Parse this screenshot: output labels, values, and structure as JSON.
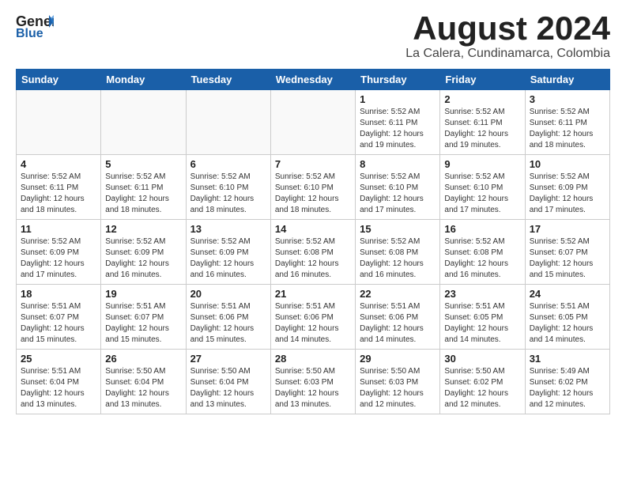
{
  "header": {
    "logo_general": "General",
    "logo_blue": "Blue",
    "month_title": "August 2024",
    "location": "La Calera, Cundinamarca, Colombia"
  },
  "weekdays": [
    "Sunday",
    "Monday",
    "Tuesday",
    "Wednesday",
    "Thursday",
    "Friday",
    "Saturday"
  ],
  "weeks": [
    [
      {
        "day": "",
        "info": ""
      },
      {
        "day": "",
        "info": ""
      },
      {
        "day": "",
        "info": ""
      },
      {
        "day": "",
        "info": ""
      },
      {
        "day": "1",
        "info": "Sunrise: 5:52 AM\nSunset: 6:11 PM\nDaylight: 12 hours\nand 19 minutes."
      },
      {
        "day": "2",
        "info": "Sunrise: 5:52 AM\nSunset: 6:11 PM\nDaylight: 12 hours\nand 19 minutes."
      },
      {
        "day": "3",
        "info": "Sunrise: 5:52 AM\nSunset: 6:11 PM\nDaylight: 12 hours\nand 18 minutes."
      }
    ],
    [
      {
        "day": "4",
        "info": "Sunrise: 5:52 AM\nSunset: 6:11 PM\nDaylight: 12 hours\nand 18 minutes."
      },
      {
        "day": "5",
        "info": "Sunrise: 5:52 AM\nSunset: 6:11 PM\nDaylight: 12 hours\nand 18 minutes."
      },
      {
        "day": "6",
        "info": "Sunrise: 5:52 AM\nSunset: 6:10 PM\nDaylight: 12 hours\nand 18 minutes."
      },
      {
        "day": "7",
        "info": "Sunrise: 5:52 AM\nSunset: 6:10 PM\nDaylight: 12 hours\nand 18 minutes."
      },
      {
        "day": "8",
        "info": "Sunrise: 5:52 AM\nSunset: 6:10 PM\nDaylight: 12 hours\nand 17 minutes."
      },
      {
        "day": "9",
        "info": "Sunrise: 5:52 AM\nSunset: 6:10 PM\nDaylight: 12 hours\nand 17 minutes."
      },
      {
        "day": "10",
        "info": "Sunrise: 5:52 AM\nSunset: 6:09 PM\nDaylight: 12 hours\nand 17 minutes."
      }
    ],
    [
      {
        "day": "11",
        "info": "Sunrise: 5:52 AM\nSunset: 6:09 PM\nDaylight: 12 hours\nand 17 minutes."
      },
      {
        "day": "12",
        "info": "Sunrise: 5:52 AM\nSunset: 6:09 PM\nDaylight: 12 hours\nand 16 minutes."
      },
      {
        "day": "13",
        "info": "Sunrise: 5:52 AM\nSunset: 6:09 PM\nDaylight: 12 hours\nand 16 minutes."
      },
      {
        "day": "14",
        "info": "Sunrise: 5:52 AM\nSunset: 6:08 PM\nDaylight: 12 hours\nand 16 minutes."
      },
      {
        "day": "15",
        "info": "Sunrise: 5:52 AM\nSunset: 6:08 PM\nDaylight: 12 hours\nand 16 minutes."
      },
      {
        "day": "16",
        "info": "Sunrise: 5:52 AM\nSunset: 6:08 PM\nDaylight: 12 hours\nand 16 minutes."
      },
      {
        "day": "17",
        "info": "Sunrise: 5:52 AM\nSunset: 6:07 PM\nDaylight: 12 hours\nand 15 minutes."
      }
    ],
    [
      {
        "day": "18",
        "info": "Sunrise: 5:51 AM\nSunset: 6:07 PM\nDaylight: 12 hours\nand 15 minutes."
      },
      {
        "day": "19",
        "info": "Sunrise: 5:51 AM\nSunset: 6:07 PM\nDaylight: 12 hours\nand 15 minutes."
      },
      {
        "day": "20",
        "info": "Sunrise: 5:51 AM\nSunset: 6:06 PM\nDaylight: 12 hours\nand 15 minutes."
      },
      {
        "day": "21",
        "info": "Sunrise: 5:51 AM\nSunset: 6:06 PM\nDaylight: 12 hours\nand 14 minutes."
      },
      {
        "day": "22",
        "info": "Sunrise: 5:51 AM\nSunset: 6:06 PM\nDaylight: 12 hours\nand 14 minutes."
      },
      {
        "day": "23",
        "info": "Sunrise: 5:51 AM\nSunset: 6:05 PM\nDaylight: 12 hours\nand 14 minutes."
      },
      {
        "day": "24",
        "info": "Sunrise: 5:51 AM\nSunset: 6:05 PM\nDaylight: 12 hours\nand 14 minutes."
      }
    ],
    [
      {
        "day": "25",
        "info": "Sunrise: 5:51 AM\nSunset: 6:04 PM\nDaylight: 12 hours\nand 13 minutes."
      },
      {
        "day": "26",
        "info": "Sunrise: 5:50 AM\nSunset: 6:04 PM\nDaylight: 12 hours\nand 13 minutes."
      },
      {
        "day": "27",
        "info": "Sunrise: 5:50 AM\nSunset: 6:04 PM\nDaylight: 12 hours\nand 13 minutes."
      },
      {
        "day": "28",
        "info": "Sunrise: 5:50 AM\nSunset: 6:03 PM\nDaylight: 12 hours\nand 13 minutes."
      },
      {
        "day": "29",
        "info": "Sunrise: 5:50 AM\nSunset: 6:03 PM\nDaylight: 12 hours\nand 12 minutes."
      },
      {
        "day": "30",
        "info": "Sunrise: 5:50 AM\nSunset: 6:02 PM\nDaylight: 12 hours\nand 12 minutes."
      },
      {
        "day": "31",
        "info": "Sunrise: 5:49 AM\nSunset: 6:02 PM\nDaylight: 12 hours\nand 12 minutes."
      }
    ]
  ]
}
